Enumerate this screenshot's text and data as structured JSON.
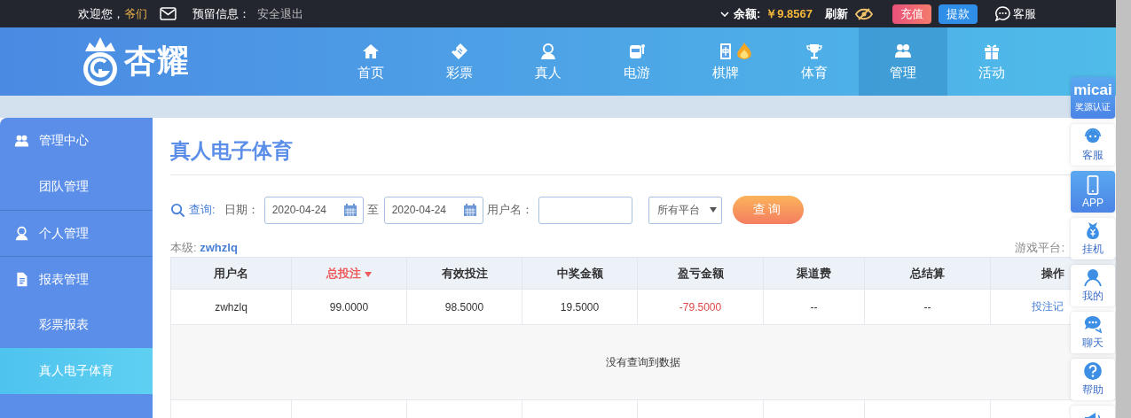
{
  "top_bar": {
    "greeting": "欢迎您，",
    "username": "爷们",
    "notice_label": "预留信息：",
    "logout": "安全退出",
    "balance_label": "余额:",
    "balance": "￥9.8567",
    "refresh": "刷新",
    "deposit": "充值",
    "withdraw": "提款",
    "service": "客服"
  },
  "logo": {
    "text": "杏耀"
  },
  "nav": [
    {
      "label": "首页",
      "kind": "home",
      "selected": false
    },
    {
      "label": "彩票",
      "kind": "ticket",
      "selected": false
    },
    {
      "label": "真人",
      "kind": "person",
      "selected": false
    },
    {
      "label": "电游",
      "kind": "slot",
      "selected": false
    },
    {
      "label": "棋牌",
      "kind": "mahjong",
      "selected": false,
      "hot": true
    },
    {
      "label": "体育",
      "kind": "trophy",
      "selected": false
    },
    {
      "label": "管理",
      "kind": "group",
      "selected": true
    },
    {
      "label": "活动",
      "kind": "gift",
      "selected": false
    }
  ],
  "sidebar": {
    "items": [
      {
        "label": "管理中心",
        "kind": "group",
        "selected": false,
        "children": [
          {
            "label": "团队管理",
            "kind": "item",
            "selected": false
          }
        ]
      },
      {
        "label": "个人管理",
        "kind": "person",
        "selected": false
      },
      {
        "label": "报表管理",
        "kind": "doc",
        "selected": false,
        "children": [
          {
            "label": "彩票报表",
            "kind": "item",
            "selected": false
          },
          {
            "label": "真人电子体育",
            "kind": "item",
            "selected": true
          }
        ]
      }
    ]
  },
  "page": {
    "title": "真人电子体育",
    "query": {
      "label": "查询:",
      "date_label": "日期：",
      "date_from": "2020-04-24",
      "to_label": "至",
      "date_to": "2020-04-24",
      "user_label": "用户名：",
      "platform": "所有平台",
      "submit": "查询"
    },
    "level_label": "本级:",
    "level_user": "zwhzlq",
    "platform_label": "游戏平台:"
  },
  "table": {
    "columns": [
      {
        "label": "用户名",
        "sorted": false
      },
      {
        "label": "总投注",
        "sorted": true
      },
      {
        "label": "有效投注",
        "sorted": false
      },
      {
        "label": "中奖金额",
        "sorted": false
      },
      {
        "label": "盈亏金额",
        "sorted": false,
        "kind": "profit"
      },
      {
        "label": "渠道费",
        "sorted": false
      },
      {
        "label": "总结算",
        "sorted": false
      },
      {
        "label": "操作",
        "sorted": false,
        "kind": "action"
      }
    ],
    "rows": [
      {
        "cells": [
          "zwhzlq",
          "99.0000",
          "98.5000",
          "19.5000",
          "-79.5000",
          "--",
          "--",
          "投注记"
        ],
        "loss": true
      }
    ],
    "empty_message": "没有查询到数据"
  },
  "float_bar": [
    {
      "kind": "brand",
      "label": "micai",
      "sub": "奖源认证",
      "highlighted": true
    },
    {
      "kind": "service",
      "label": "客服",
      "highlighted": false
    },
    {
      "kind": "phone",
      "label": "APP",
      "highlighted": true
    },
    {
      "kind": "bag",
      "label": "挂机",
      "highlighted": false
    },
    {
      "kind": "person",
      "label": "我的",
      "highlighted": false
    },
    {
      "kind": "chat",
      "label": "聊天",
      "highlighted": false
    },
    {
      "kind": "help",
      "label": "帮助",
      "highlighted": false
    },
    {
      "kind": "speaker",
      "highlighted": false
    }
  ]
}
